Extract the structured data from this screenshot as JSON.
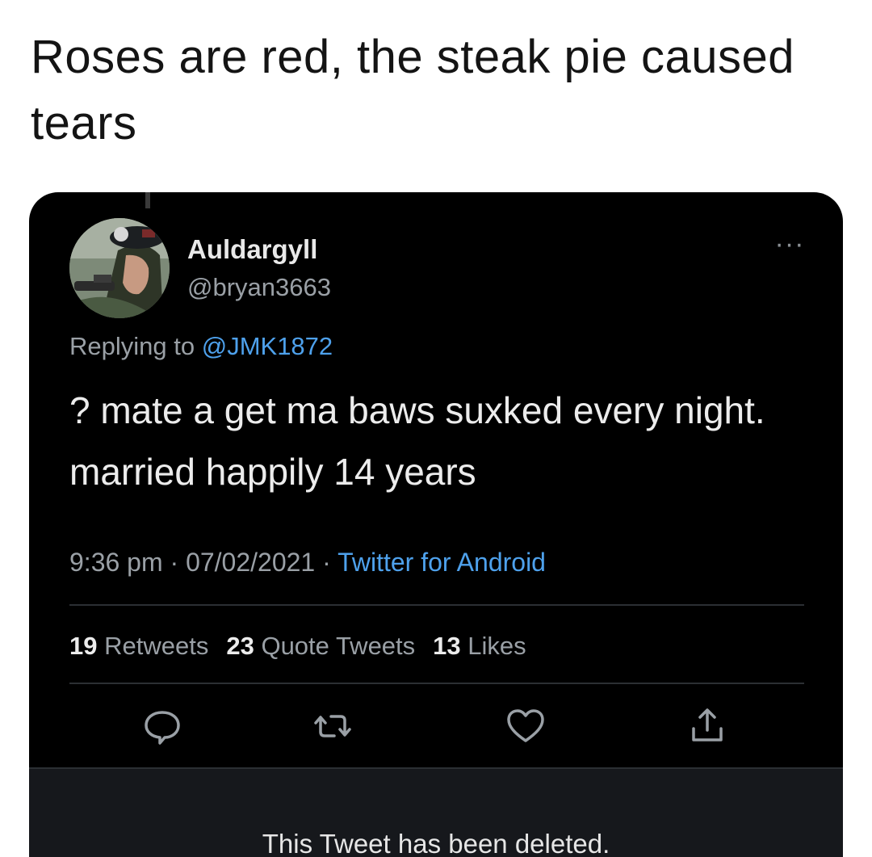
{
  "caption": "Roses are red, the steak pie caused tears",
  "tweet": {
    "display_name": "Auldargyll",
    "handle": "@bryan3663",
    "replying_prefix": "Replying to ",
    "replying_to": "@JMK1872",
    "text": "? mate a get ma baws suxked every night. married happily 14 years",
    "time": "9:36 pm",
    "date": "07/02/2021",
    "separator": "·",
    "source": "Twitter for Android",
    "stats": {
      "retweets_count": "19",
      "retweets_label": "Retweets",
      "quote_count": "23",
      "quote_label": "Quote Tweets",
      "likes_count": "13",
      "likes_label": "Likes"
    },
    "more_label": "···",
    "actions": [
      "reply-icon",
      "retweet-icon",
      "like-icon",
      "share-icon"
    ]
  },
  "deleted_notice": "This Tweet has been deleted.",
  "colors": {
    "card_background": "#000000",
    "link_blue": "#4ea1ec",
    "muted_gray": "#9aa0a6",
    "text_white": "#ececec"
  }
}
